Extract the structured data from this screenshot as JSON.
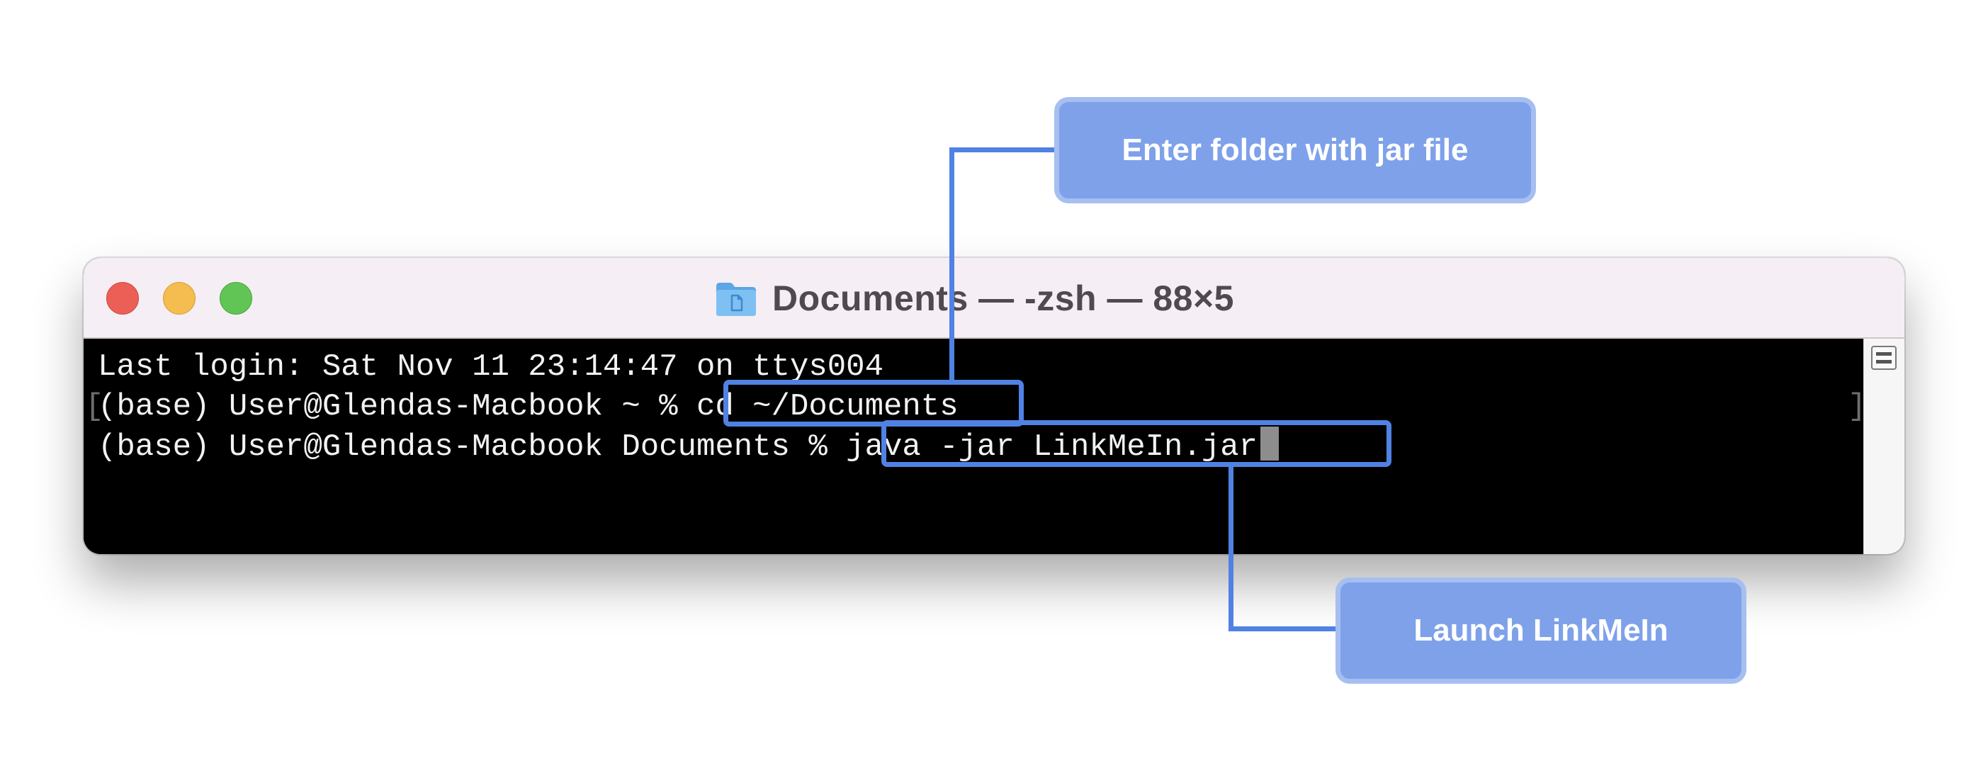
{
  "window": {
    "title": "Documents — -zsh — 88×5",
    "folder_icon": "folder-icon",
    "buttons": [
      "close",
      "minimize",
      "zoom"
    ]
  },
  "terminal": {
    "lines": [
      "Last login: Sat Nov 11 23:14:47 on ttys004",
      "(base) User@Glendas-Macbook ~ % ",
      "(base) User@Glendas-Macbook Documents % "
    ],
    "command_1": "cd ~/Documents",
    "command_2": "java -jar LinkMeIn.jar",
    "left_bracket": "[",
    "right_bracket": "]"
  },
  "callouts": {
    "top": "Enter folder with jar file",
    "bottom": "Launch LinkMeIn"
  },
  "colors": {
    "highlight": "#4f82e3",
    "callout_fill": "#7ea1ea",
    "callout_border": "#a6bff0",
    "terminal_bg": "#000000",
    "terminal_text": "#f2f2f2"
  }
}
